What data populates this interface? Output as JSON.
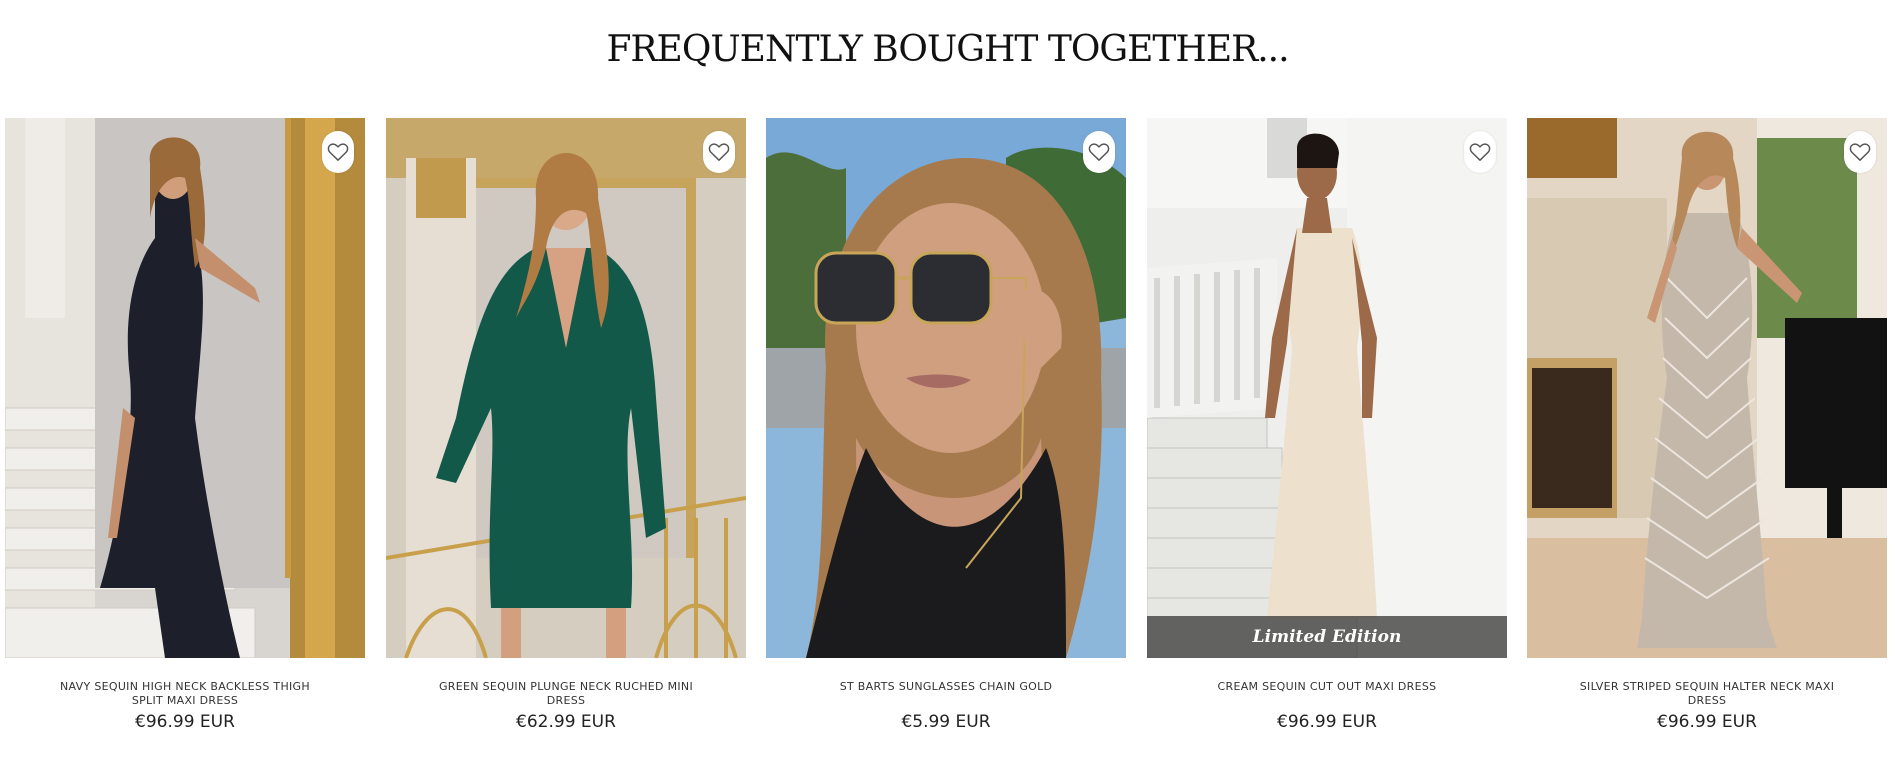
{
  "section": {
    "title": "FREQUENTLY BOUGHT TOGETHER..."
  },
  "products": [
    {
      "name": "NAVY SEQUIN HIGH NECK BACKLESS THIGH SPLIT MAXI DRESS",
      "price": "€96.99 EUR",
      "wishlist_icon": "heart-outline-icon"
    },
    {
      "name": "GREEN SEQUIN PLUNGE NECK RUCHED MINI DRESS",
      "price": "€62.99 EUR",
      "wishlist_icon": "heart-outline-icon"
    },
    {
      "name": "ST BARTS SUNGLASSES CHAIN GOLD",
      "price": "€5.99 EUR",
      "wishlist_icon": "heart-outline-icon"
    },
    {
      "name": "CREAM SEQUIN CUT OUT MAXI DRESS",
      "price": "€96.99 EUR",
      "wishlist_icon": "heart-outline-icon",
      "badge": "Limited Edition"
    },
    {
      "name": "SILVER STRIPED SEQUIN HALTER NECK MAXI DRESS",
      "price": "€96.99 EUR",
      "wishlist_icon": "heart-outline-icon"
    }
  ]
}
